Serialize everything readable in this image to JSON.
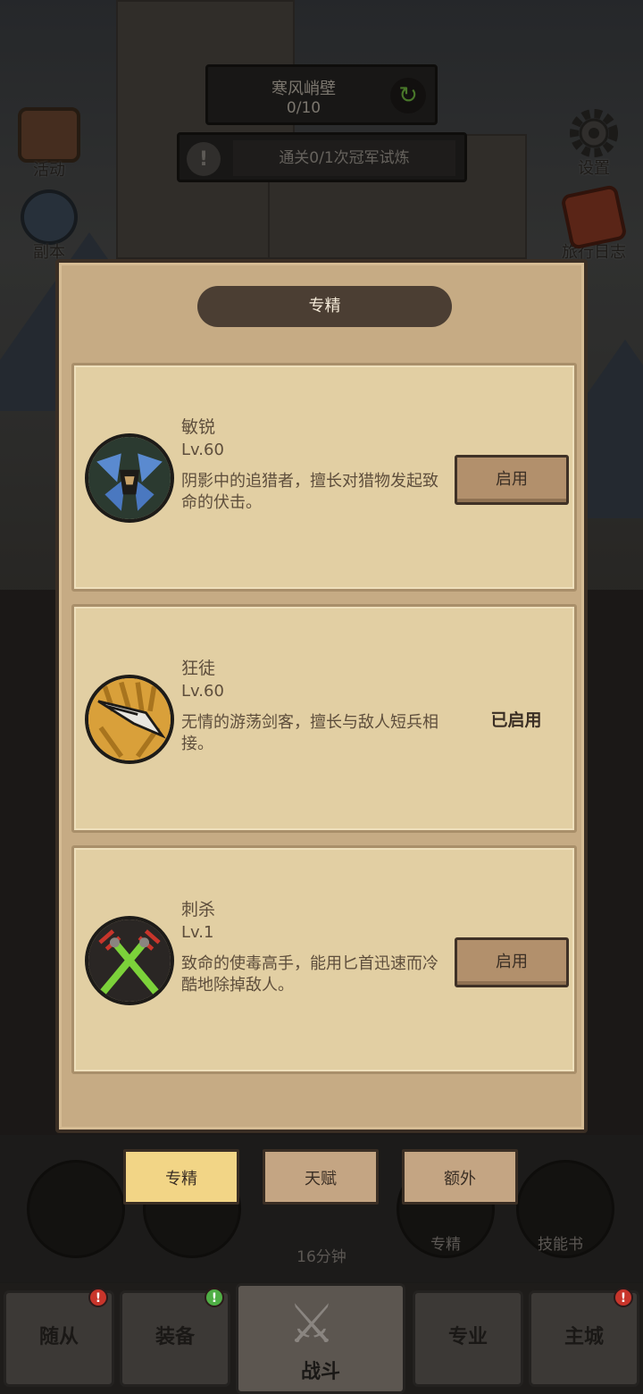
{
  "hud": {
    "zone_name": "寒风峭壁",
    "zone_progress": "0/10",
    "quest_text": "通关0/1次冠军试炼"
  },
  "side_icons": {
    "activity": "活动",
    "dungeon": "副本",
    "settings": "设置",
    "journal": "旅行日志"
  },
  "panel": {
    "title": "专精",
    "cards": [
      {
        "name": "敏锐",
        "level": "Lv.60",
        "description": "阴影中的追猎者，擅长对猎物发起致命的伏击。",
        "action": "启用",
        "icon": "hooded-rogue-icon"
      },
      {
        "name": "狂徒",
        "level": "Lv.60",
        "description": "无情的游荡剑客，擅长与敌人短兵相接。",
        "status": "已启用",
        "icon": "sword-blade-icon"
      },
      {
        "name": "刺杀",
        "level": "Lv.1",
        "description": "致命的使毒高手，能用匕首迅速而冷酷地除掉敌人。",
        "action": "启用",
        "icon": "crossed-daggers-icon"
      }
    ]
  },
  "sub_tabs": {
    "spec": "专精",
    "talent": "天赋",
    "extra": "额外",
    "active": "spec"
  },
  "lower": {
    "timer": "16分钟",
    "spec_label": "专精",
    "skillbook_label": "技能书"
  },
  "nav": {
    "follower": "随从",
    "equipment": "装备",
    "battle": "战斗",
    "profession": "专业",
    "main_city": "主城",
    "badge_follower": "!",
    "badge_equipment": "!",
    "badge_city": "!"
  },
  "colors": {
    "panel_bg": "#c6ab84",
    "card_bg": "#e2cfa3",
    "active_tab": "#f2d586",
    "badge_red": "#c8352b",
    "badge_green": "#4fae45",
    "refresh_green": "#6fb53f"
  }
}
